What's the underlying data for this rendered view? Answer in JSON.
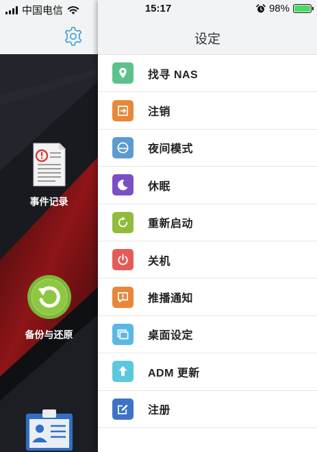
{
  "status_bar": {
    "carrier": "中国电信",
    "time": "15:17",
    "battery_percent": "98%",
    "battery_level": 0.98
  },
  "drawer": {
    "items": [
      {
        "label": "事件记录",
        "icon": "event-log-icon"
      },
      {
        "label": "备份与还原",
        "icon": "backup-restore-icon"
      },
      {
        "label": "",
        "icon": "profile-card-icon"
      }
    ]
  },
  "panel": {
    "title": "设定"
  },
  "menu": [
    {
      "label": "找寻 NAS",
      "icon": "location-pin-icon",
      "color": "#5cc28c"
    },
    {
      "label": "注销",
      "icon": "logout-icon",
      "color": "#e8873a"
    },
    {
      "label": "夜间模式",
      "icon": "night-mode-icon",
      "color": "#5b9bd0"
    },
    {
      "label": "休眠",
      "icon": "moon-icon",
      "color": "#7d4fc4"
    },
    {
      "label": "重新启动",
      "icon": "restart-icon",
      "color": "#8fbc3c"
    },
    {
      "label": "关机",
      "icon": "power-icon",
      "color": "#e65a57"
    },
    {
      "label": "推播通知",
      "icon": "notification-icon",
      "color": "#e8873a"
    },
    {
      "label": "桌面设定",
      "icon": "desktop-icon",
      "color": "#5bb8e6"
    },
    {
      "label": "ADM 更新",
      "icon": "update-icon",
      "color": "#5cc8dc"
    },
    {
      "label": "注册",
      "icon": "register-icon",
      "color": "#3f73c8"
    }
  ]
}
